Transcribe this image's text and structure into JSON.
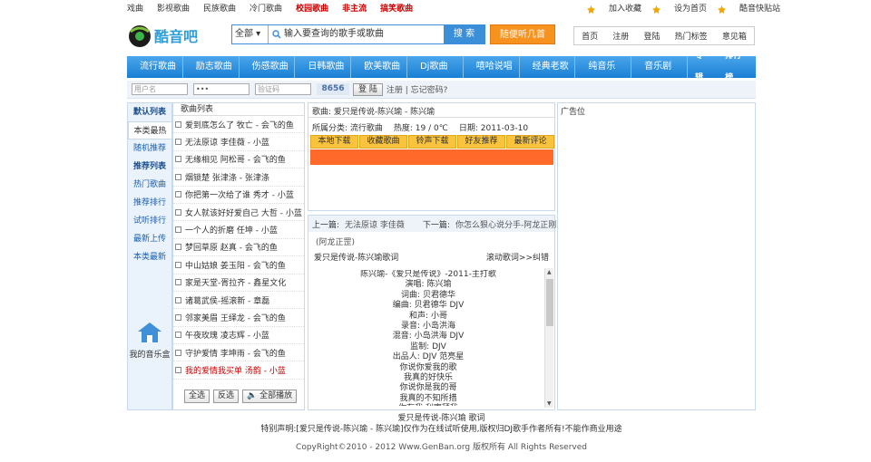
{
  "top_links": [
    "戏曲",
    "影视歌曲",
    "民族歌曲",
    "冷门歌曲",
    "校园歌曲",
    "非主流",
    "搞笑歌曲"
  ],
  "hot_from": 4,
  "right_links": [
    {
      "label": "加入收藏",
      "icon": "star-icon"
    },
    {
      "label": "设为首页",
      "icon": "home-icon"
    },
    {
      "label": "酷音快贴站",
      "icon": "clip-icon"
    }
  ],
  "logo": {
    "text": "酷音吧"
  },
  "search": {
    "scope": "全部",
    "placeholder": "输入要查询的歌手或歌曲",
    "button": "搜 索"
  },
  "random_button": "随便听几首",
  "util_nav": [
    "首页",
    "注册",
    "登陆",
    "热门标签",
    "意见箱"
  ],
  "main_nav": [
    "流行歌曲",
    "励志歌曲",
    "伤感歌曲",
    "日韩歌曲",
    "欧美歌曲",
    "Dj歌曲",
    "嘻哈说唱",
    "经典老歌",
    "纯音乐",
    "音乐剧"
  ],
  "main_nav_right": [
    "专辑",
    "排行榜"
  ],
  "login": {
    "user_placeholder": "用户名",
    "password": "•••",
    "captcha_placeholder": "验证码",
    "captcha": "8656",
    "login_button": "登 陆",
    "links": "注册 | 忘记密码?"
  },
  "left_menu": [
    {
      "label": "默认列表",
      "bold": true
    },
    {
      "label": "本类最热",
      "selected": true
    },
    {
      "label": "随机推荐"
    },
    {
      "label": "推荐列表",
      "bold": true
    },
    {
      "label": "热门歌曲"
    },
    {
      "label": "推荐排行"
    },
    {
      "label": "试听排行"
    },
    {
      "label": "最新上传"
    },
    {
      "label": "本类最新"
    }
  ],
  "music_box": "我的音乐盒",
  "song_list": {
    "header": "歌曲列表",
    "items": [
      "爱到底怎么了 牧亡 - 会飞的鱼",
      "无法原谅 李佳薇 - 小蓝",
      "无缘相见 阿松哥 - 会飞的鱼",
      "烟锁楚 张津涤 - 张津涤",
      "你把第一次给了谁 秀才 - 小蓝",
      "女人就该好好爱自己 大哲 - 小蓝",
      "一个人的折磨 任坤 - 小蓝",
      "梦回草原 赵真 - 会飞的鱼",
      "中山姑娘 姜玉阳 - 会飞的鱼",
      "家是天堂-胥拉齐 - 鑫星文化",
      "诸葛武侯-摇滚新 - 章磊",
      "邻家美眉 王绎龙 - 会飞的鱼",
      "午夜玫瑰 凌志辉 - 小蓝",
      "守护爱情 李坤雨 - 会飞的鱼",
      "我的爱情我买单 汤韵 - 小蓝"
    ],
    "red_index": 14,
    "buttons": [
      "全选",
      "反选",
      "全部播放"
    ]
  },
  "detail": {
    "title": "歌曲: 爱只是传说-陈兴瑜 - 陈兴瑜",
    "category": "所属分类: 流行歌曲",
    "heat": "热度: 19 / 0℃",
    "date": "日期: 2011-03-10",
    "actions": [
      "本地下载",
      "收藏歌曲",
      "铃声下载",
      "好友推荐",
      "最新评论"
    ]
  },
  "lyrics": {
    "prev_label": "上一篇:",
    "prev": "无法原谅 李佳薇",
    "next_label": "下一篇:",
    "next": "你怎么狠心说分手-阿龙正刚",
    "agent": "(阿龙正罡)",
    "title": "爱只是传说-陈兴瑜歌词",
    "scroll": "滚动歌词>>纠错",
    "lines": [
      "陈兴瑜-《爱只是传说》-2011-主打歌",
      "演唱: 陈兴瑜",
      "词曲: 贝君德华",
      "编曲: 贝君德华 DJV",
      "和声: 小哥",
      "录音: 小岛洪海",
      "混音: 小岛洪海 DJV",
      "监制: DJV",
      "出品人: DJV 范亮星",
      "你说你爱我的歌",
      "我真的好快乐",
      "你说你是我的哥",
      "我真的不知所措",
      "你有我 利害拜我"
    ]
  },
  "ad": "广告位",
  "footer": {
    "line1": "爱只是传说-陈兴瑜 歌词",
    "line2": "特别声明:[爱只是传说-陈兴瑜 - 陈兴瑜]仅作为在线试听使用,版权归DJ歌手作者所有!不能作商业用途",
    "copyright": "CopyRight©2010 - 2012 Www.GenBan.org 版权所有 All Rights Reserved"
  },
  "colors": {
    "nav_blue": "#2a8fdf",
    "orange": "#f7921e",
    "action_yellow": "#f9c33e",
    "red_bar": "#ff6a2a"
  }
}
